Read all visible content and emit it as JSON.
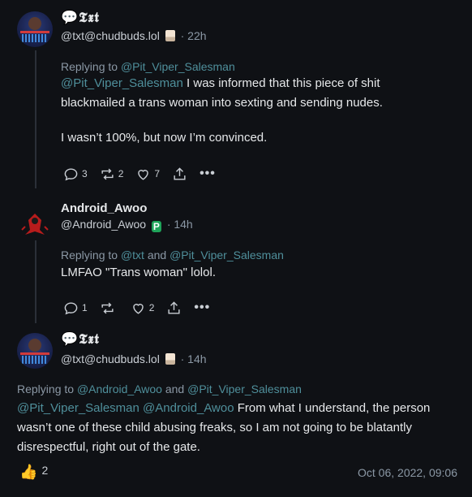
{
  "posts": [
    {
      "display_name": "💬𝕿𝖝𝖙",
      "handle": "@txt@chudbuds.lol",
      "time": "· 22h",
      "replying_prefix": "Replying to ",
      "replying_to": [
        "@Pit_Viper_Salesman"
      ],
      "mention": "@Pit_Viper_Salesman",
      "text_1": " I was informed that this piece of shit blackmailed a trans woman into sexting and sending nudes.",
      "text_2": "I wasn’t 100%, but now I’m convinced.",
      "replies": "3",
      "boosts": "2",
      "likes": "7"
    },
    {
      "display_name": "Android_Awoo",
      "handle": "@Android_Awoo",
      "time": "· 14h",
      "replying_prefix": "Replying to ",
      "replying_to": [
        "@txt",
        "@Pit_Viper_Salesman"
      ],
      "replying_join": " and ",
      "text_1": "LMFAO \"Trans woman\" lolol.",
      "replies": "1",
      "boosts": "",
      "likes": "2"
    },
    {
      "display_name": "💬𝕿𝖝𝖙",
      "handle": "@txt@chudbuds.lol",
      "time": "· 14h",
      "replying_prefix": "Replying to ",
      "replying_to": [
        "@Android_Awoo",
        "@Pit_Viper_Salesman"
      ],
      "replying_join": " and ",
      "mention_1": "@Pit_Viper_Salesman",
      "mention_2": "@Android_Awoo",
      "text_1": " From what I understand, the person wasn’t one of these child abusing freaks, so I am not going to be blatantly disrespectful, right out of the gate.",
      "reaction_count": "2",
      "date": "Oct 06, 2022, 09:06"
    }
  ],
  "icons": {
    "reply": "reply-icon",
    "boost": "boost-icon",
    "like": "heart-icon",
    "share": "share-icon",
    "more": "more-icon",
    "reaction": "thumbs-up-icon"
  },
  "colors": {
    "background": "#0f1115",
    "mention": "#4f8f9b",
    "muted": "#8b98a5"
  }
}
